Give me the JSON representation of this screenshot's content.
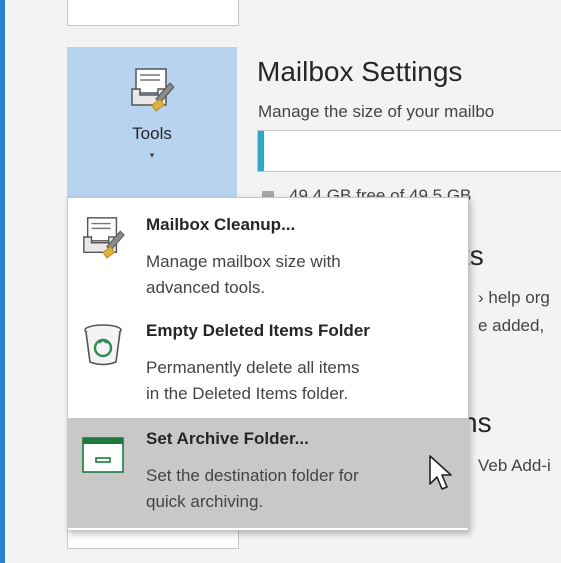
{
  "tools_button": {
    "label": "Tools",
    "caret": "▾",
    "icon": "mailbox-tools-icon"
  },
  "mailbox_settings": {
    "title": "Mailbox Settings",
    "description": "Manage the size of your mailbo",
    "storage_free_fraction": 0.02,
    "storage_text": "49.4 GB free of 49.5 GB",
    "colors": {
      "fill": "#2ba9c7"
    }
  },
  "rules_section": {
    "title_fragment": "ts",
    "desc_line1": "› help org",
    "desc_line2": "e added,"
  },
  "addins_section": {
    "title_fragment": "ns",
    "desc_line1": "Veb Add-i"
  },
  "menu": {
    "items": [
      {
        "title": "Mailbox Cleanup...",
        "desc1": "Manage mailbox size with",
        "desc2": "advanced tools.",
        "icon": "mailbox-cleanup-icon"
      },
      {
        "title": "Empty Deleted Items Folder",
        "desc1": "Permanently delete all items",
        "desc2": "in the Deleted Items folder.",
        "icon": "recycle-bin-icon"
      },
      {
        "title": "Set Archive Folder...",
        "desc1": "Set the destination folder for",
        "desc2": "quick archiving.",
        "icon": "archive-folder-icon"
      }
    ]
  },
  "colors": {
    "accent": "#2b7fd1",
    "tools_bg": "#b7d3f0",
    "hover": "#c8c8c8"
  }
}
